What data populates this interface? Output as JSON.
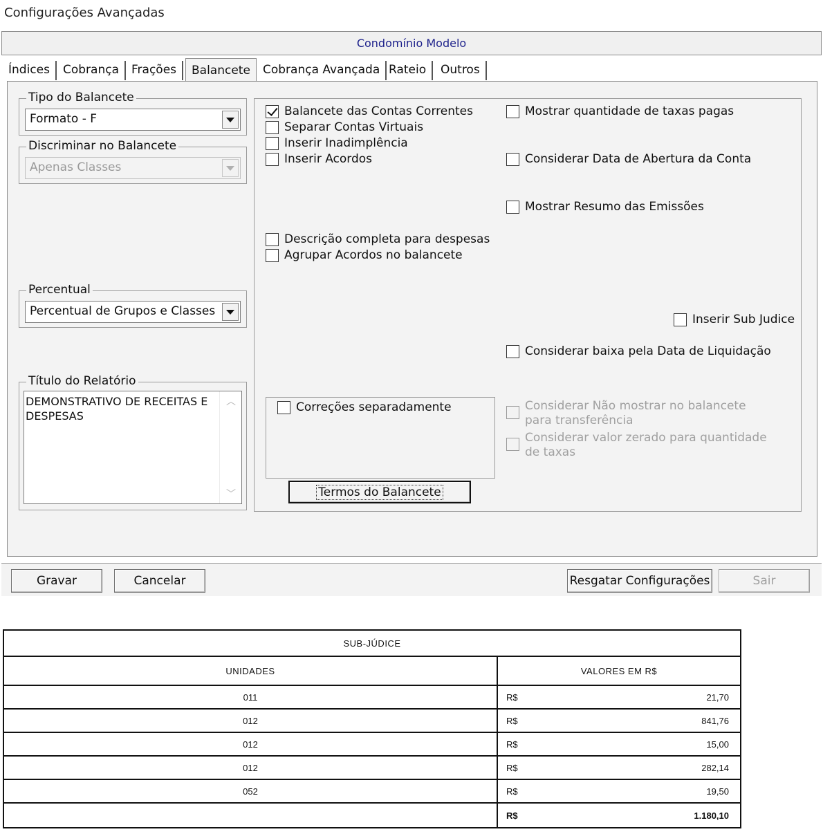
{
  "window": {
    "title": "Configurações Avançadas"
  },
  "banner": {
    "text": "Condomínio Modelo"
  },
  "tabs": [
    {
      "label": "Índices",
      "active": false
    },
    {
      "label": "Cobrança",
      "active": false
    },
    {
      "label": "Frações",
      "active": false
    },
    {
      "label": "Balancete",
      "active": true
    },
    {
      "label": "Cobrança Avançada",
      "active": false
    },
    {
      "label": "Rateio",
      "active": false
    },
    {
      "label": "Outros",
      "active": false
    }
  ],
  "left": {
    "tipo": {
      "legend": "Tipo do Balancete",
      "value": "Formato - F"
    },
    "discriminar": {
      "legend": "Discriminar no Balancete",
      "value": "Apenas Classes",
      "disabled": true
    },
    "percentual": {
      "legend": "Percentual",
      "value": "Percentual de Grupos e Classes"
    },
    "titulo": {
      "legend": "Título do Relatório",
      "value": "DEMONSTRATIVO DE RECEITAS E DESPESAS"
    }
  },
  "options": {
    "balancete_contas": {
      "label": "Balancete das Contas Correntes",
      "checked": true
    },
    "separar_virtuais": {
      "label": "Separar Contas Virtuais",
      "checked": false
    },
    "inserir_inadimplencia": {
      "label": "Inserir Inadimplência",
      "checked": false
    },
    "inserir_acordos": {
      "label": "Inserir Acordos",
      "checked": false
    },
    "descricao_completa": {
      "label": "Descrição completa para despesas",
      "checked": false
    },
    "agrupar_acordos": {
      "label": "Agrupar Acordos no balancete",
      "checked": false
    },
    "mostrar_qtd_taxas": {
      "label": "Mostrar quantidade de taxas pagas",
      "checked": false
    },
    "considerar_abertura": {
      "label": "Considerar Data de Abertura da Conta",
      "checked": false
    },
    "mostrar_resumo": {
      "label": "Mostrar Resumo das Emissões",
      "checked": false
    },
    "inserir_sub_judice": {
      "label": "Inserir Sub Judice",
      "checked": false
    },
    "considerar_liquidacao": {
      "label": "Considerar baixa pela Data de Liquidação",
      "checked": false
    },
    "correcoes_separadamente": {
      "label": "Correções separadamente",
      "checked": false
    },
    "nao_mostrar_transferencia": {
      "label": "Considerar Não mostrar no balancete para transferência",
      "checked": false,
      "disabled": true
    },
    "valor_zerado": {
      "label": "Considerar valor zerado para quantidade de taxas",
      "checked": false,
      "disabled": true
    }
  },
  "buttons": {
    "termos": "Termos do Balancete",
    "gravar": "Gravar",
    "cancelar": "Cancelar",
    "resgatar": "Resgatar Configurações",
    "sair": "Sair"
  },
  "report": {
    "title": "SUB-JÚDICE",
    "col_units": "UNIDADES",
    "col_values": "VALORES EM R$",
    "currency": "R$",
    "rows": [
      {
        "unit": "011",
        "value": "21,70"
      },
      {
        "unit": "012",
        "value": "841,76"
      },
      {
        "unit": "012",
        "value": "15,00"
      },
      {
        "unit": "012",
        "value": "282,14"
      },
      {
        "unit": "052",
        "value": "19,50"
      }
    ],
    "total": "1.180,10"
  }
}
